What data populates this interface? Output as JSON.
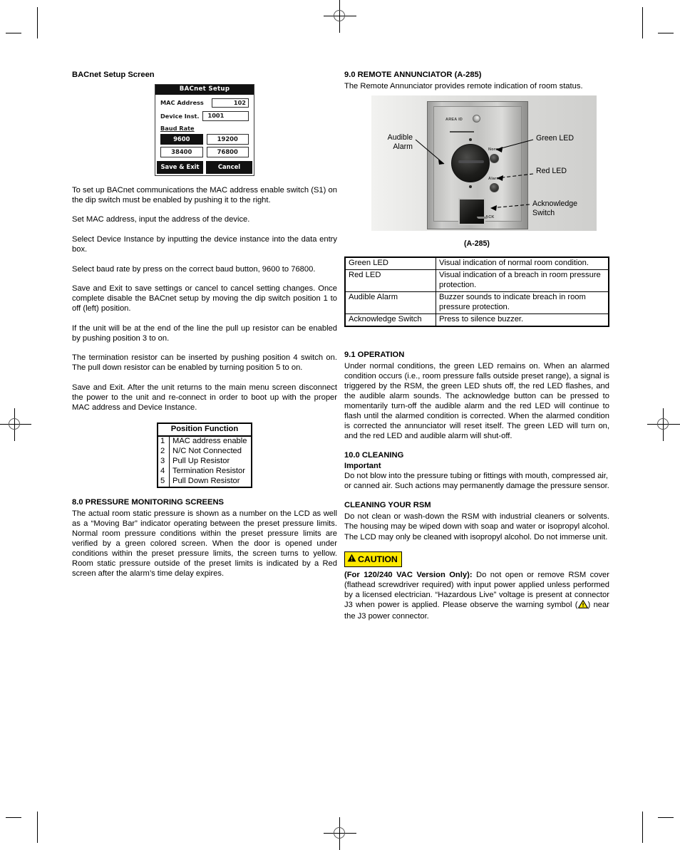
{
  "left_column": {
    "heading": "BACnet Setup Screen",
    "lcd": {
      "title": "BACnet Setup",
      "mac_label": "MAC Address",
      "mac_value": "102",
      "device_label": "Device Inst.",
      "device_value": "1001",
      "baud_label": "Baud Rate",
      "baud_buttons": [
        {
          "label": "9600",
          "selected": true
        },
        {
          "label": "19200",
          "selected": false
        },
        {
          "label": "38400",
          "selected": false
        },
        {
          "label": "76800",
          "selected": false
        }
      ],
      "save_label": "Save & Exit",
      "cancel_label": "Cancel"
    },
    "paragraphs": [
      "To set up BACnet communications the MAC address enable switch (S1) on the dip switch must be enabled by pushing it to the right.",
      "Set MAC address, input the address of the device.",
      "Select Device Instance by inputting the device instance into the data entry box.",
      "Select baud rate by press on the correct baud button, 9600 to 76800.",
      "Save and Exit to save settings or cancel to cancel setting changes. Once complete disable the BACnet setup by moving the dip switch position 1 to off (left) position.",
      "If the unit will be at the end of the line the pull up resistor can be enabled by pushing position 3 to on.",
      "The termination resistor can be inserted by pushing position 4 switch on. The pull down resistor can be enabled by turning position 5 to on.",
      "Save and Exit. After the unit returns to the main menu screen disconnect the power to the unit and re-connect in order to boot up with the proper MAC address and Device Instance."
    ],
    "position_table": {
      "header": "Position Function",
      "rows": [
        {
          "num": "1",
          "fn": "MAC address enable"
        },
        {
          "num": "2",
          "fn": "N/C Not Connected"
        },
        {
          "num": "3",
          "fn": "Pull Up Resistor"
        },
        {
          "num": "4",
          "fn": "Termination Resistor"
        },
        {
          "num": "5",
          "fn": "Pull Down Resistor"
        }
      ]
    },
    "section_8": {
      "heading": "8.0 PRESSURE MONITORING SCREENS",
      "body": "The actual room static pressure is shown as a number on the LCD as well as a “Moving Bar” indicator operating between the preset pressure limits. Normal room pressure conditions within the preset pressure limits are verified by a green colored screen. When the door is opened under conditions within the preset pressure limits, the screen turns to yellow. Room static pressure outside of the preset limits is indicated by a Red screen after the alarm’s time delay expires."
    }
  },
  "right_column": {
    "section_9": {
      "heading": "9.0 REMOTE ANNUNCIATOR (A-285)",
      "intro": "The Remote Annunciator provides remote indication of room status."
    },
    "figure": {
      "caption": "(A-285)",
      "panel_labels": {
        "area_id": "AREA ID",
        "normal": "Normal",
        "alarm": "Alarm",
        "ack": "ACK"
      },
      "callouts": [
        {
          "name": "audible-alarm",
          "line1": "Audible",
          "line2": "Alarm"
        },
        {
          "name": "green-led",
          "line1": "Green LED",
          "line2": ""
        },
        {
          "name": "red-led",
          "line1": "Red LED",
          "line2": ""
        },
        {
          "name": "acknowledge-switch",
          "line1": "Acknowledge",
          "line2": "Switch"
        }
      ]
    },
    "led_table": {
      "rows": [
        {
          "key": "Green LED",
          "value": "Visual indication of normal room condition."
        },
        {
          "key": "Red LED",
          "value": "Visual indication of a breach in room pressure protection."
        },
        {
          "key": "Audible Alarm",
          "value": "Buzzer sounds to indicate breach in room pressure protection."
        },
        {
          "key": "Acknowledge Switch",
          "value": "Press to silence buzzer."
        }
      ]
    },
    "section_91": {
      "heading": "9.1 OPERATION",
      "body": "Under normal conditions, the green LED remains on. When an alarmed condition occurs (i.e., room pressure falls outside preset range), a signal is triggered by the RSM, the green LED shuts off, the red LED flashes, and the audible alarm sounds. The acknowledge button can be pressed to momentarily turn-off the audible alarm and the red LED will continue to flash until the alarmed condition is corrected. When the alarmed condition is corrected the annunciator will reset itself. The green LED will turn on, and the red LED and audible alarm will shut-off."
    },
    "section_10": {
      "heading": "10.0 CLEANING",
      "subheading": "Important",
      "body": "Do not blow into the pressure tubing or fittings with mouth, compressed air, or canned air. Such actions may permanently damage the pressure sensor."
    },
    "cleaning_rsm": {
      "heading": "CLEANING YOUR RSM",
      "body": "Do not clean or wash-down the RSM with industrial cleaners or solvents. The housing may be wiped down with soap and water or isopropyl alcohol. The LCD may only be cleaned with isopropyl alcohol. Do not immerse unit."
    },
    "caution": {
      "badge_label": "CAUTION",
      "badge_bg": "#FFE800",
      "lead": "(For 120/240 VAC Version Only):",
      "body_part1": " Do not open or remove RSM cover (flathead screwdriver required) with input power applied unless performed by a licensed electrician. “Hazardous Live” voltage is present at connector J3 when power is applied. Please observe the warning symbol (",
      "body_part2": ") near the J3 power connector."
    }
  }
}
